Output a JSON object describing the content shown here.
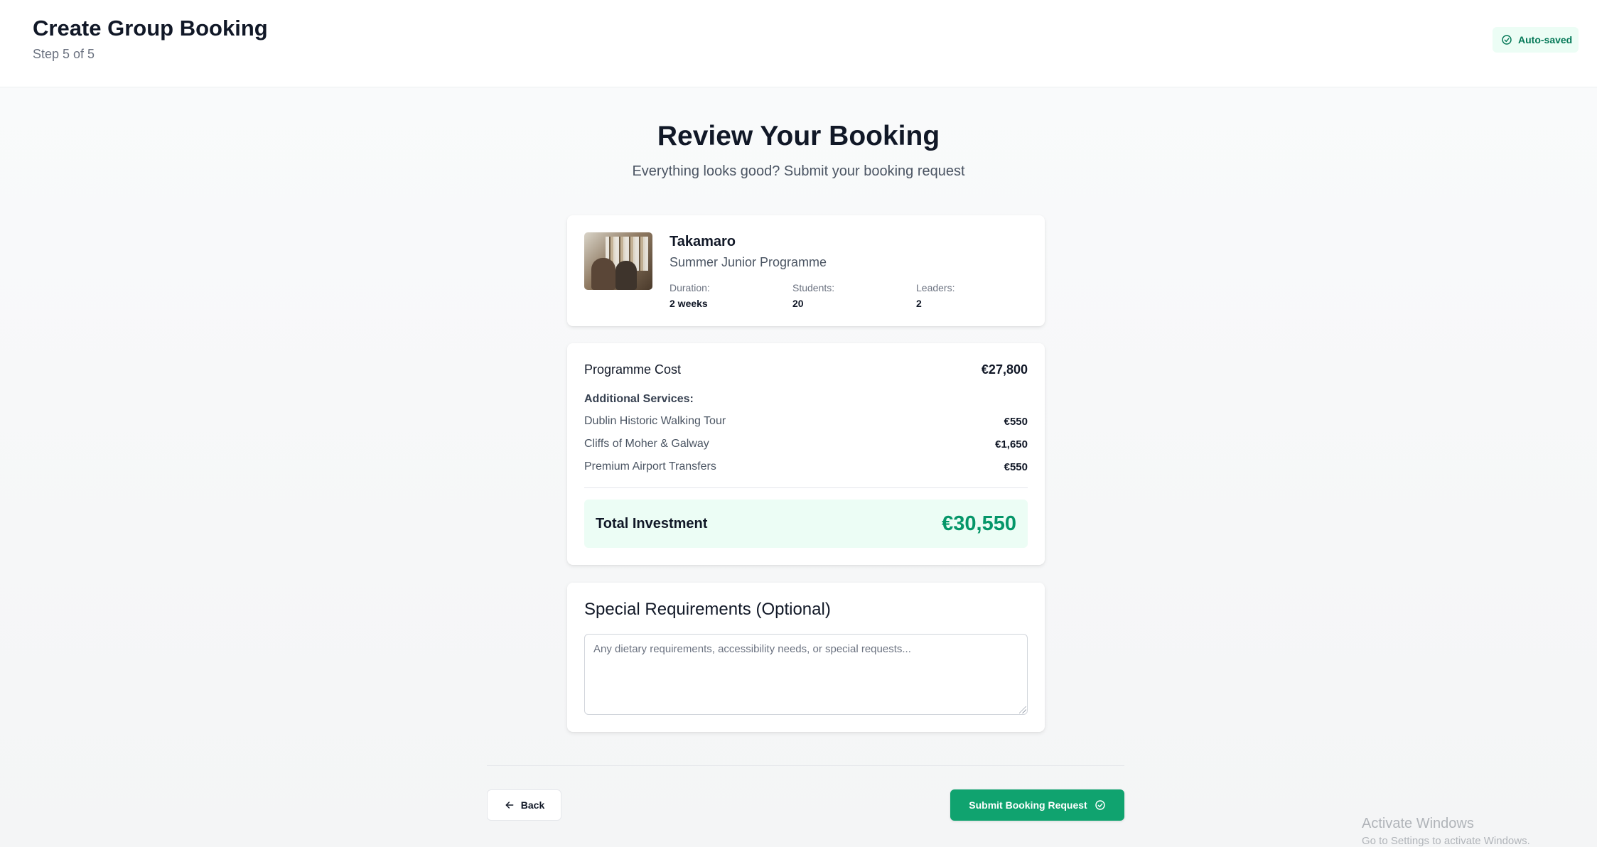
{
  "header": {
    "title": "Create Group Booking",
    "step": "Step 5 of 5",
    "autosave_label": "Auto-saved",
    "autosave_icon": "check-circle-icon"
  },
  "review": {
    "title": "Review Your Booking",
    "subtitle": "Everything looks good? Submit your booking request"
  },
  "programme": {
    "name": "Takamaro",
    "type": "Summer Junior Programme",
    "stats": [
      {
        "label": "Duration:",
        "value": "2 weeks"
      },
      {
        "label": "Students:",
        "value": "20"
      },
      {
        "label": "Leaders:",
        "value": "2"
      }
    ]
  },
  "cost": {
    "programme_label": "Programme Cost",
    "programme_amount": "€27,800",
    "additional_heading": "Additional Services:",
    "services": [
      {
        "name": "Dublin Historic Walking Tour",
        "amount": "€550"
      },
      {
        "name": "Cliffs of Moher & Galway",
        "amount": "€1,650"
      },
      {
        "name": "Premium Airport Transfers",
        "amount": "€550"
      }
    ],
    "total_label": "Total Investment",
    "total_amount": "€30,550"
  },
  "special": {
    "title": "Special Requirements (Optional)",
    "placeholder": "Any dietary requirements, accessibility needs, or special requests...",
    "value": ""
  },
  "footer": {
    "back_label": "Back",
    "back_icon": "arrow-left-icon",
    "submit_label": "Submit Booking Request",
    "submit_icon": "check-circle-icon"
  },
  "watermark": {
    "title": "Activate Windows",
    "subtitle": "Go to Settings to activate Windows."
  },
  "colors": {
    "accent": "#10a36f",
    "total_text": "#059669",
    "total_bg": "#ecfdf5",
    "autosave_text": "#047857"
  }
}
